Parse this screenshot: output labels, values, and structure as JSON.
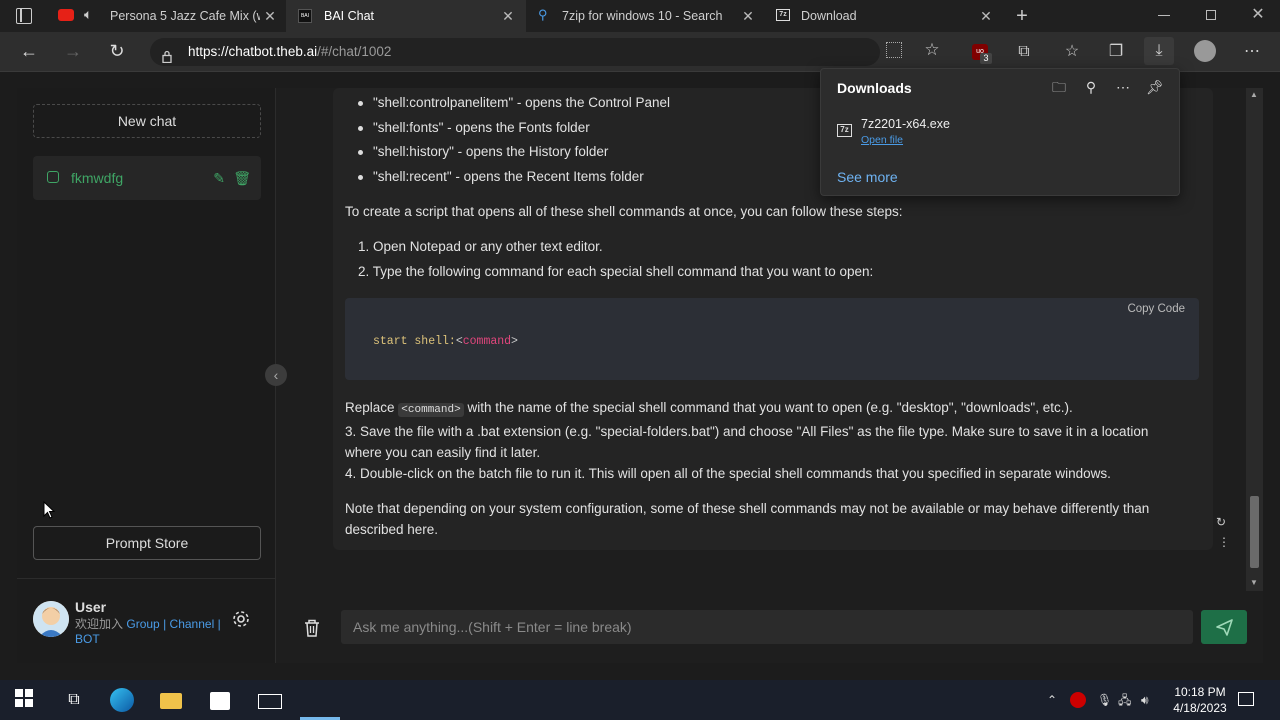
{
  "browser": {
    "tabs": [
      {
        "title": "Persona 5 Jazz Cafe Mix (w/",
        "icon": "youtube-icon",
        "active": false
      },
      {
        "title": "BAI Chat",
        "icon": "bai-icon",
        "active": true
      },
      {
        "title": "7zip for windows 10 - Search",
        "icon": "search-icon",
        "active": false
      },
      {
        "title": "Download",
        "icon": "7zip-icon",
        "active": false
      }
    ],
    "url_host": "https://chatbot.theb.ai",
    "url_path": "/#/chat/1002",
    "extension_badge": "3"
  },
  "downloads": {
    "title": "Downloads",
    "file_name": "7z2201-x64.exe",
    "open_file": "Open file",
    "see_more": "See more",
    "file_icon_text": "7z"
  },
  "sidebar": {
    "new_chat": "New chat",
    "chats": [
      {
        "title": "fkmwdfg"
      }
    ],
    "prompt_store": "Prompt Store",
    "user": {
      "name": "User",
      "welcome": "欢迎加入",
      "links": [
        "Group",
        "Channel",
        "BOT"
      ],
      "separator": "|"
    }
  },
  "message": {
    "bullets": [
      "\"shell:controlpanelitem\" - opens the Control Panel",
      "\"shell:fonts\" - opens the Fonts folder",
      "\"shell:history\" - opens the History folder",
      "\"shell:recent\" - opens the Recent Items folder"
    ],
    "intro": "To create a script that opens all of these shell commands at once, you can follow these steps:",
    "steps": [
      "1. Open Notepad or any other text editor.",
      "2. Type the following command for each special shell command that you want to open:"
    ],
    "code_copy": "Copy  Code",
    "code_prefix": "start shell:",
    "code_open": "<",
    "code_keyword": "command",
    "code_close": ">",
    "replace_before": "Replace",
    "replace_inline": "<command>",
    "replace_after": "with the name of the special shell command that you want to open (e.g. \"desktop\", \"downloads\", etc.).",
    "step3_line1": "3. Save the file with a .bat extension (e.g. \"special-folders.bat\") and choose \"All Files\" as the file type. Make sure to save it in a location",
    "step3_line2": "where you can easily find it later.",
    "step4": "4. Double-click on the batch file to run it. This will open all of the special shell commands that you specified in separate windows.",
    "note_line1": "Note that depending on your system configuration, some of these shell commands may not be available or may behave differently than",
    "note_line2": "described here."
  },
  "input": {
    "placeholder": "Ask me anything...(Shift + Enter = line break)"
  },
  "taskbar": {
    "time": "10:18 PM",
    "date": "4/18/2023"
  },
  "colors": {
    "accent_green": "#3fa565",
    "send_button": "#1e6f47",
    "link_blue": "#4a9be6"
  }
}
